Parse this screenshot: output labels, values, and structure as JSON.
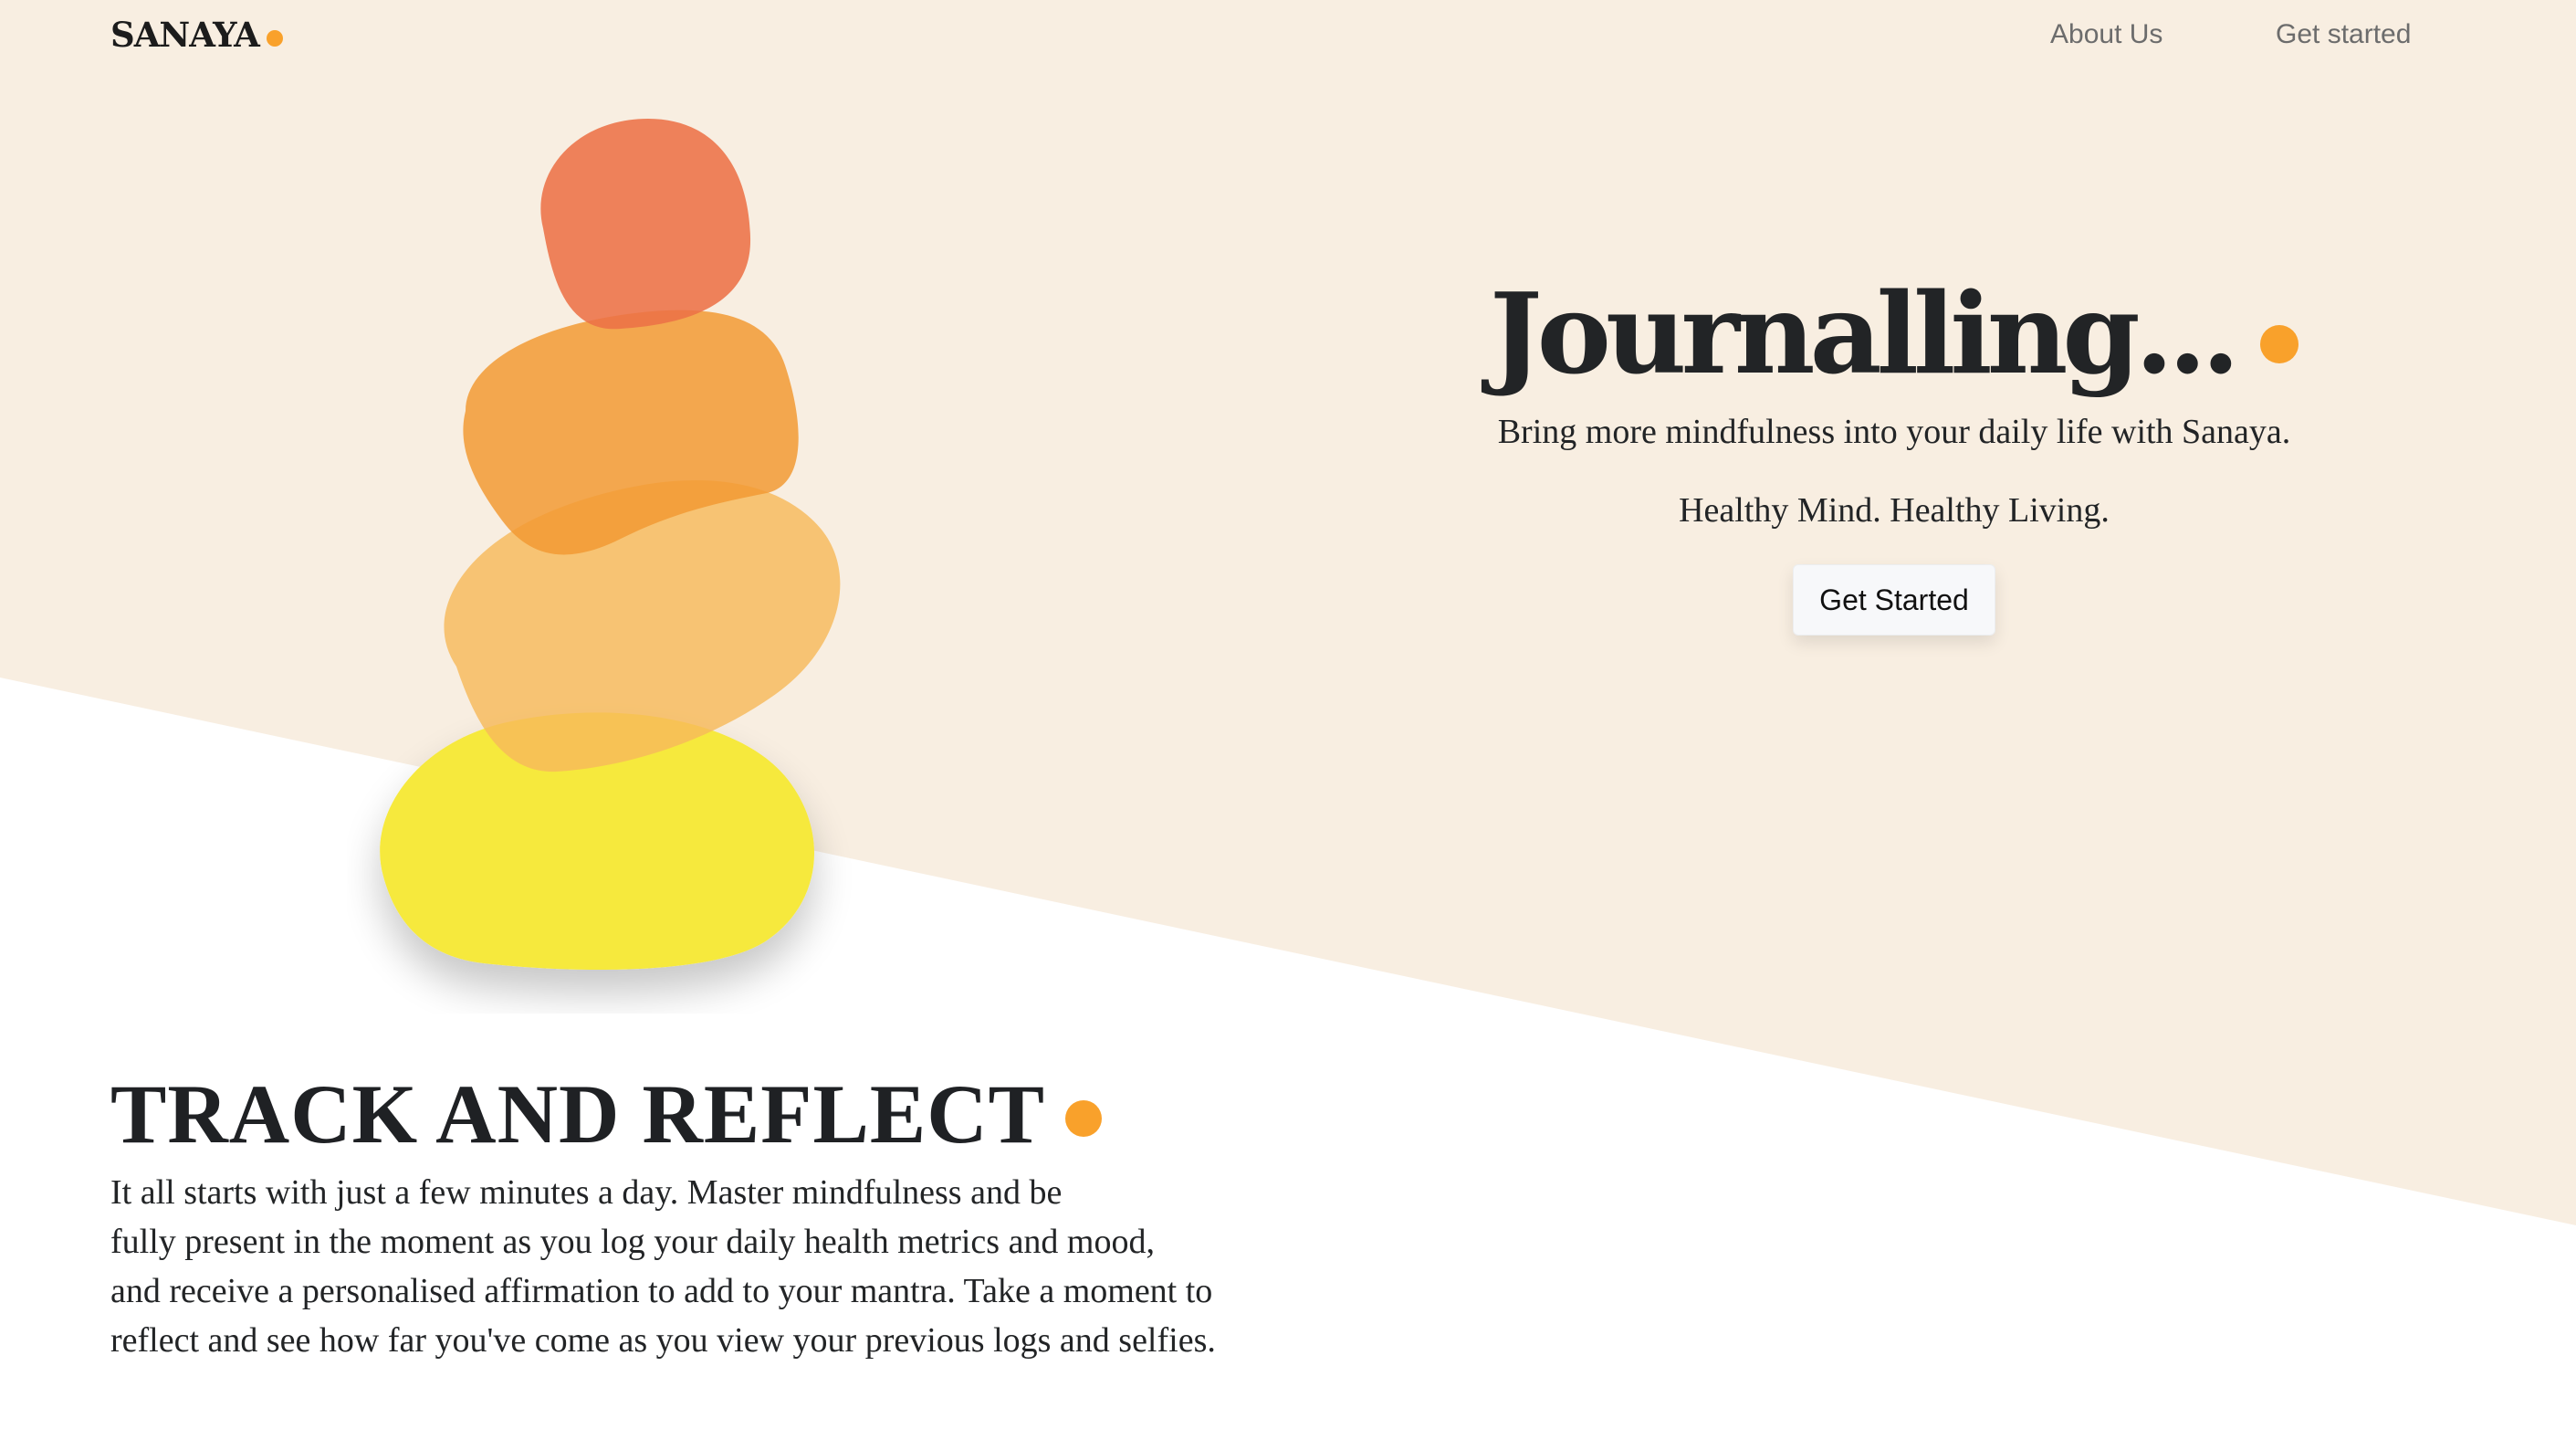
{
  "nav": {
    "brand": "SANAYA",
    "links": [
      {
        "label": "About Us"
      },
      {
        "label": "Get started"
      }
    ]
  },
  "hero": {
    "title": "Journalling...",
    "subtitle": "Bring more mindfulness into your daily life with Sanaya.",
    "tagline": "Healthy Mind. Healthy Living.",
    "button_label": "Get Started"
  },
  "track": {
    "title": "TRACK AND REFLECT",
    "lines": [
      "It all starts with just a few minutes a day. Master mindfulness and be",
      "fully present in the moment as you log your daily health metrics and mood,",
      "and receive a personalised affirmation to add to your mantra. Take a moment to",
      "reflect and see how far you've come as you view your previous logs and selfies."
    ]
  },
  "colors": {
    "background_cream": "#f8eee1",
    "accent_orange": "#f9a12b",
    "stone_coral": "#ee7e58",
    "stone_orange": "#f4a24a",
    "stone_light_orange": "#f7c26f",
    "stone_yellow": "#f6e93c"
  }
}
